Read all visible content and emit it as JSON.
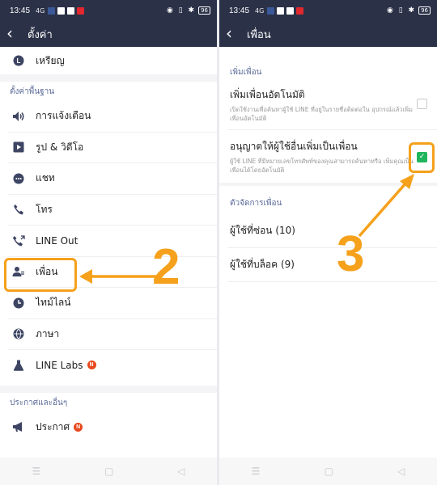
{
  "left": {
    "status": {
      "time": "13:45",
      "signal": "4G",
      "battery": "96"
    },
    "header": {
      "title": "ตั้งค่า"
    },
    "top_item": {
      "label": "เหรียญ",
      "icon": "coin-icon"
    },
    "section_basic": "ตั้งค่าพื้นฐาน",
    "items": [
      {
        "label": "การแจ้งเตือน",
        "icon": "speaker-icon"
      },
      {
        "label": "รูป & วิดีโอ",
        "icon": "play-icon"
      },
      {
        "label": "แชท",
        "icon": "chat-icon"
      },
      {
        "label": "โทร",
        "icon": "phone-icon"
      },
      {
        "label": "LINE Out",
        "icon": "line-out-phone-icon"
      },
      {
        "label": "เพื่อน",
        "icon": "friends-icon"
      },
      {
        "label": "ไทม์ไลน์",
        "icon": "clock-icon"
      },
      {
        "label": "ภาษา",
        "icon": "globe-icon"
      },
      {
        "label": "LINE Labs",
        "icon": "flask-icon",
        "badge": "N"
      }
    ],
    "section_news": "ประกาศและอื่นๆ",
    "news_items": [
      {
        "label": "ประกาศ",
        "icon": "megaphone-icon",
        "badge": "N"
      }
    ],
    "step_label": "2"
  },
  "right": {
    "status": {
      "time": "13:45",
      "signal": "4G",
      "battery": "96"
    },
    "header": {
      "title": "เพื่อน"
    },
    "section_add": "เพิ่มเพื่อน",
    "auto_add": {
      "title": "เพิ่มเพื่อนอัตโนมัติ",
      "desc": "เปิดใช้งานเพื่อค้นหาผู้ใช้ LINE ที่อยู่ในรายชื่อติดต่อใน อุปกรณ์แล้วเพิ่มเพื่อนอัตโนมัติ",
      "checked": false
    },
    "allow_add": {
      "title": "อนุญาตให้ผู้ใช้อื่นเพิ่มเป็นเพื่อน",
      "desc": "ผู้ใช้ LINE ที่มีหมายเลขโทรศัพท์ของคุณสามารถค้นหาหรือ เพิ่มคุณเป็นเพื่อนได้โดยอัตโนมัติ",
      "checked": true
    },
    "section_manage": "ตัวจัดการเพื่อน",
    "hidden_users": "ผู้ใช้ที่ซ่อน (10)",
    "blocked_users": "ผู้ใช้ที่บล็อค (9)",
    "step_label": "3"
  },
  "colors": {
    "header": "#2b3147",
    "accent": "#f5a11b",
    "check": "#1fb55b",
    "badge": "#e8481c",
    "section": "#5b6b9a"
  }
}
